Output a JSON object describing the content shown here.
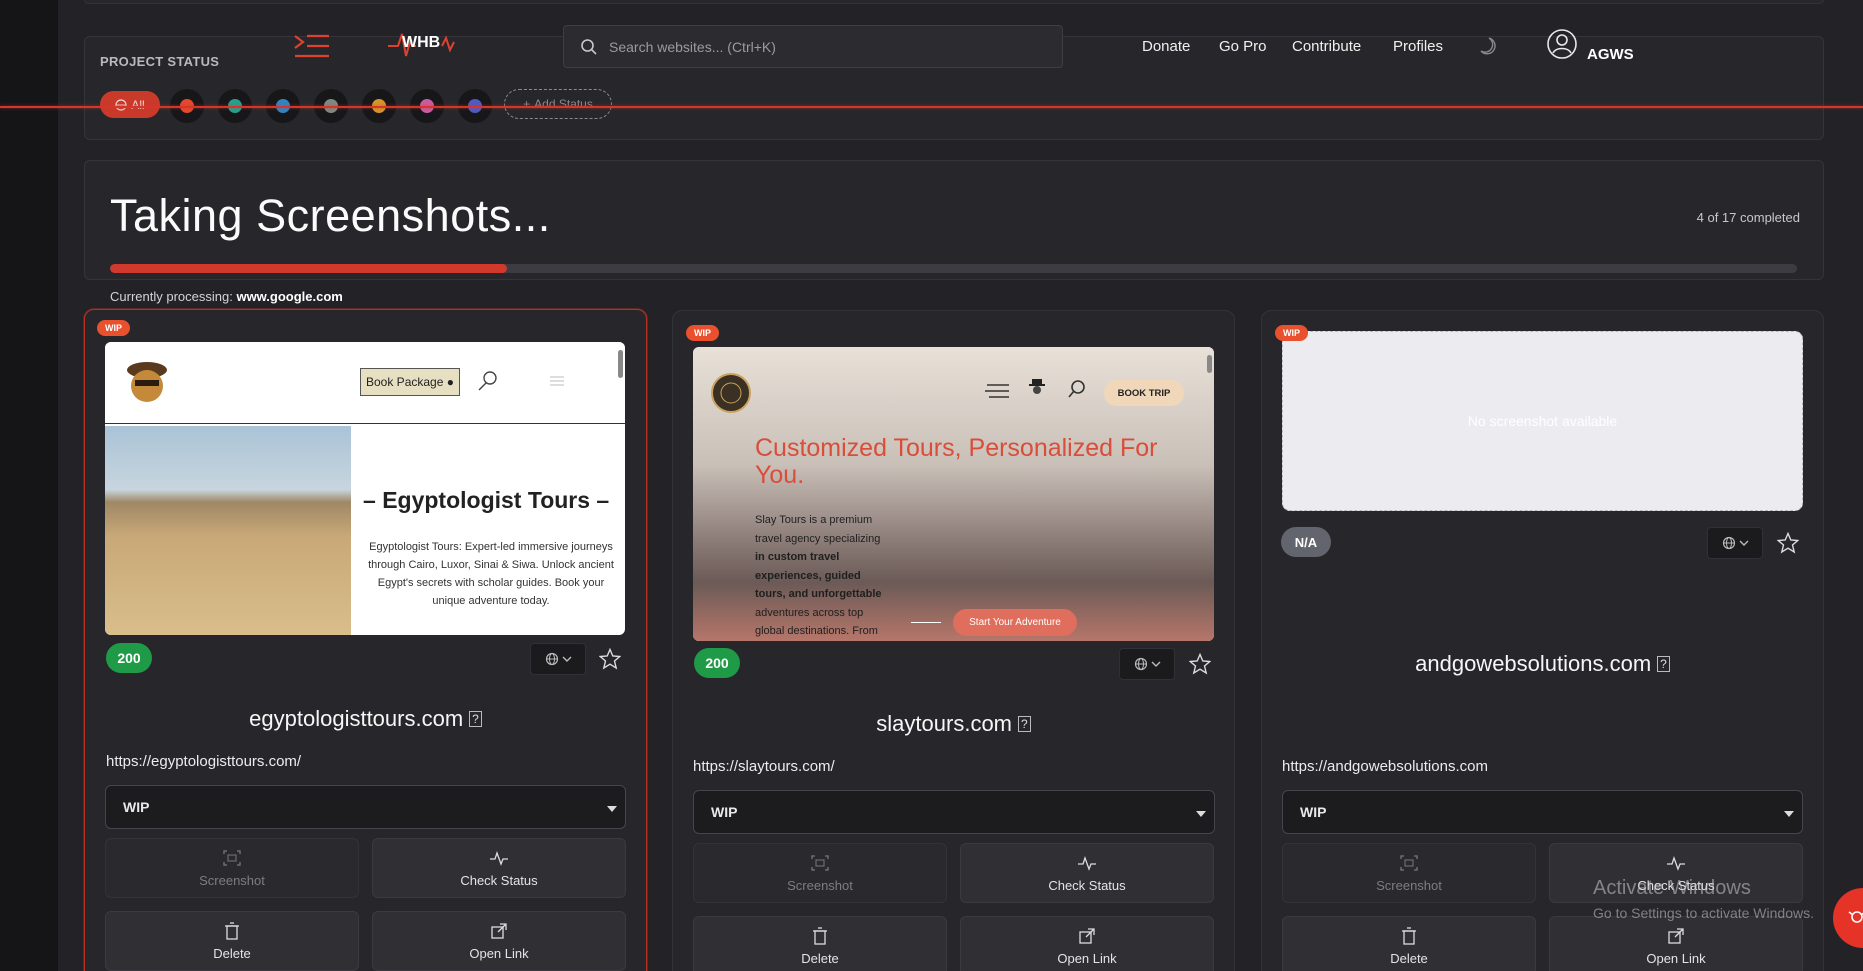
{
  "header": {
    "project_status_label": "PROJECT STATUS",
    "logo_text": "WHB",
    "search_placeholder": "Search websites... (Ctrl+K)",
    "nav": [
      "Donate",
      "Go Pro",
      "Contribute",
      "Profiles"
    ],
    "user_name": "AGWS",
    "filter_all": "All",
    "add_status": "Add Status",
    "status_colors": [
      "#e2492d",
      "#25a18e",
      "#2d86c4",
      "#7d8a80",
      "#d4952a",
      "#c95ca0",
      "#4d5bc4"
    ]
  },
  "progress": {
    "title": "Taking Screenshots...",
    "completed_text": "4 of 17 completed",
    "completed": 4,
    "total": 17,
    "processing_label": "Currently processing:",
    "processing_site": "www.google.com"
  },
  "cards": [
    {
      "badge": "WIP",
      "http_status": "200",
      "domain": "egyptologisttours.com",
      "url": "https://egyptologisttours.com/",
      "status_select": "WIP",
      "screenshot": {
        "book_label": "Book Package",
        "title": "Egyptologist Tours",
        "desc": "Egyptologist Tours: Expert-led immersive journeys through Cairo, Luxor, Sinai & Siwa. Unlock ancient Egypt's secrets with scholar guides. Book your unique adventure today."
      }
    },
    {
      "badge": "WIP",
      "http_status": "200",
      "domain": "slaytours.com",
      "url": "https://slaytours.com/",
      "status_select": "WIP",
      "screenshot": {
        "book_label": "BOOK TRIP",
        "title": "Customized Tours, Personalized For You.",
        "desc_lines": [
          "Slay Tours is a premium",
          "travel agency specializing",
          "in custom travel",
          "experiences, guided",
          "tours, and unforgettable",
          "adventures across top",
          "global destinations. From"
        ],
        "cta": "Start Your Adventure"
      }
    },
    {
      "badge": "WIP",
      "http_status": "N/A",
      "domain": "andgowebsolutions.com",
      "url": "https://andgowebsolutions.com",
      "status_select": "WIP",
      "screenshot": {
        "empty_text": "No screenshot available"
      }
    }
  ],
  "actions": {
    "screenshot": "Screenshot",
    "check_status": "Check Status",
    "delete": "Delete",
    "open_link": "Open Link"
  },
  "watermark": {
    "line1": "Activate Windows",
    "line2": "Go to Settings to activate Windows."
  }
}
